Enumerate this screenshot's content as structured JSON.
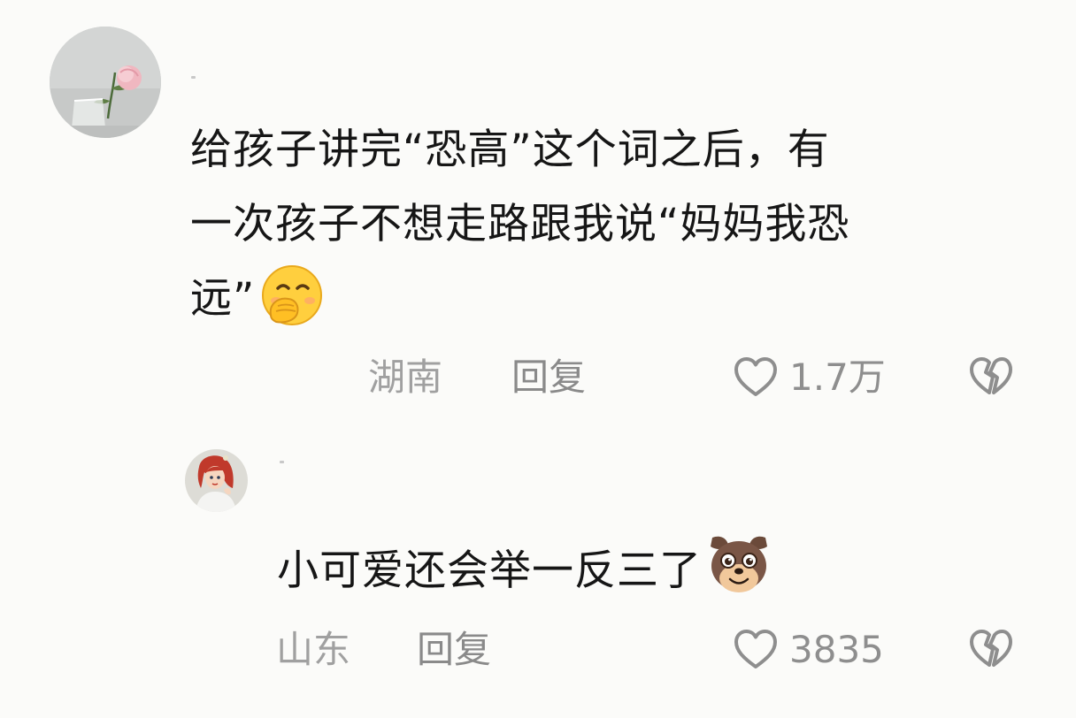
{
  "comments": [
    {
      "avatar_icon": "rose-in-vase-avatar",
      "text_lines": [
        "给孩子讲完“恐高”这个词之后，有",
        "一次孩子不想走路跟我说“妈妈我恐",
        "远”"
      ],
      "emoji": "hand-over-mouth-emoji",
      "location": "湖南",
      "reply_label": "回复",
      "likes": "1.7万"
    },
    {
      "avatar_icon": "cartoon-princess-avatar",
      "text_lines": [
        "小可爱还会举一反三了"
      ],
      "emoji": "dog-face-emoji",
      "location": "山东",
      "reply_label": "回复",
      "likes": "3835"
    }
  ],
  "icons": {
    "like": "heart-icon",
    "dislike": "broken-heart-icon"
  },
  "colors": {
    "background": "#fbfbf9",
    "text": "#161616",
    "meta": "#a0a0a0",
    "icon_stroke": "#8e8e8e"
  }
}
